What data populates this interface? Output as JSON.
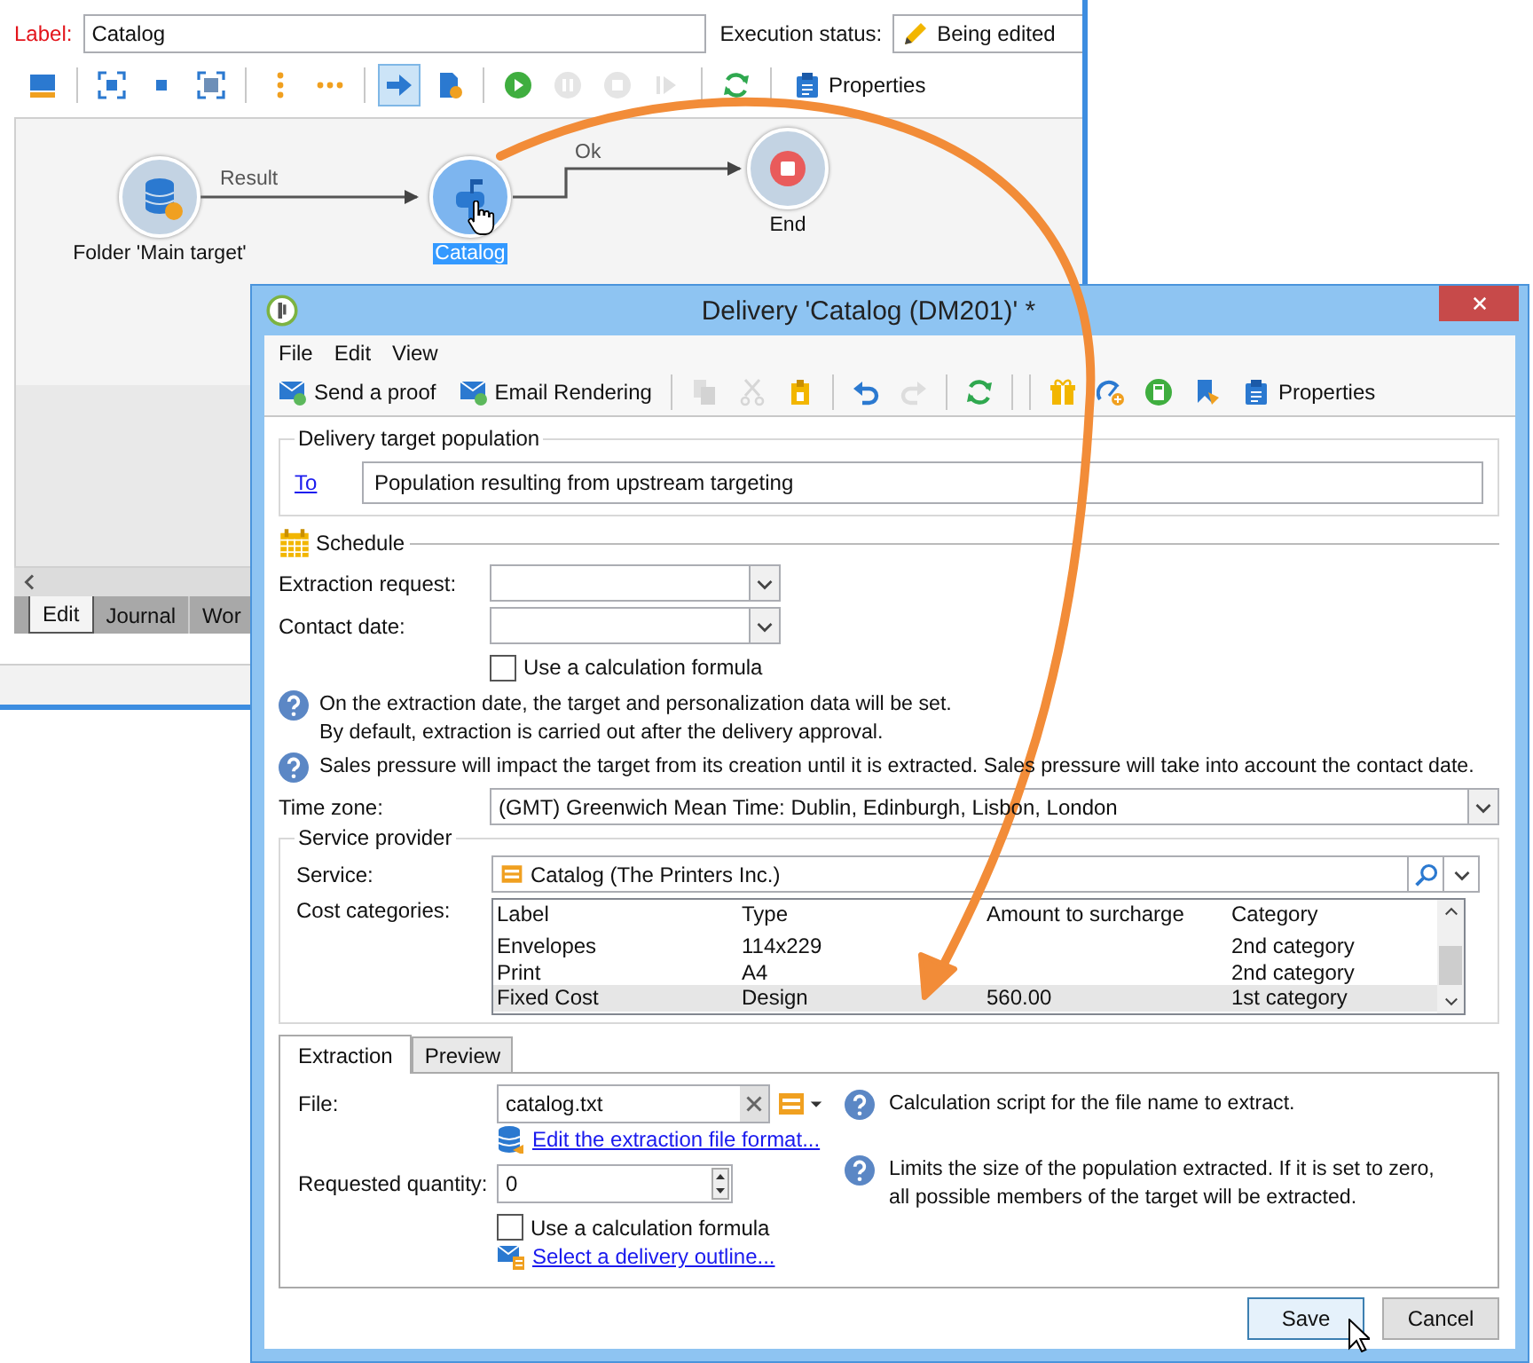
{
  "main_window": {
    "label_caption": "Label:",
    "label_value": "Catalog",
    "status_caption": "Execution status:",
    "status_value": "Being edited",
    "toolbar": [
      {
        "pressed": false,
        "disabled": false
      },
      {
        "pressed": false,
        "disabled": false
      },
      {
        "pressed": false,
        "disabled": false
      },
      {
        "pressed": false,
        "disabled": false
      },
      {
        "pressed": false,
        "disabled": false
      },
      {
        "pressed": false,
        "disabled": false
      },
      {
        "pressed": true,
        "disabled": false
      },
      {
        "pressed": false,
        "disabled": false
      },
      {
        "pressed": false,
        "disabled": false
      },
      {
        "pressed": false,
        "disabled": true
      },
      {
        "pressed": false,
        "disabled": true
      },
      {
        "pressed": false,
        "disabled": true
      },
      {
        "pressed": false,
        "disabled": false
      },
      {
        "pressed": false,
        "disabled": false,
        "label": "Properties"
      }
    ],
    "workflow": {
      "nodes": [
        {
          "label": "Folder 'Main target'",
          "selected": false
        },
        {
          "label": "Catalog",
          "selected": true
        },
        {
          "label": "End",
          "selected": false
        }
      ],
      "transitions": [
        {
          "label": "Result"
        },
        {
          "label": "Ok"
        }
      ]
    },
    "tabs": [
      {
        "label": "Edit",
        "selected": true
      },
      {
        "label": "Journal",
        "selected": false
      },
      {
        "label": "Wor",
        "selected": false
      }
    ]
  },
  "dialog": {
    "title": "Delivery 'Catalog (DM201)' *",
    "menu": [
      "File",
      "Edit",
      "View"
    ],
    "toolbar": [
      {
        "label": "Send a proof",
        "disabled": false
      },
      {
        "label": "Email Rendering",
        "disabled": false
      },
      {
        "disabled": true
      },
      {
        "disabled": true
      },
      {
        "disabled": false
      },
      {
        "disabled": false
      },
      {
        "disabled": true
      },
      {
        "disabled": false
      },
      {
        "disabled": false
      },
      {
        "disabled": false
      },
      {
        "disabled": false
      },
      {
        "disabled": false
      },
      {
        "label": "Properties",
        "disabled": false
      }
    ],
    "target_population": {
      "title": "Delivery target population",
      "link": "To",
      "value": "Population resulting from upstream targeting"
    },
    "schedule": {
      "title": "Schedule",
      "extraction_request_label": "Extraction request:",
      "contact_date_label": "Contact date:",
      "formula": {
        "label": "Use a calculation formula",
        "checked": false
      }
    },
    "notes": [
      "On the extraction date, the target and personalization data will be set.\nBy default, extraction is carried out after the delivery approval.",
      "Sales pressure will impact the target from its creation until it is extracted. Sales pressure will take into account the contact date."
    ],
    "time_zone": {
      "label": "Time zone:",
      "value": "(GMT) Greenwich Mean Time: Dublin, Edinburgh, Lisbon, London"
    },
    "service_provider": {
      "title": "Service provider",
      "service_label": "Service:",
      "service_value": "Catalog (The Printers Inc.)",
      "costs_label": "Cost categories:",
      "table": {
        "columns": [
          "Label",
          "Type",
          "Amount to surcharge",
          "Category"
        ],
        "rows": [
          {
            "label": "Envelopes",
            "type": "114x229",
            "category": "2nd category",
            "selected": false
          },
          {
            "label": "Print",
            "type": "A4",
            "category": "2nd category",
            "selected": false
          },
          {
            "label": "Fixed Cost",
            "type": "Design",
            "amount": "560.00",
            "category": "1st category",
            "selected": true
          }
        ]
      }
    },
    "tabs": [
      {
        "label": "Extraction",
        "selected": true
      },
      {
        "label": "Preview",
        "selected": false
      }
    ],
    "extraction": {
      "file_label": "File:",
      "file_value": "catalog.txt",
      "file_hint": "Calculation script for the file name to extract.",
      "format_link": "Edit the extraction file format...",
      "quantity_label": "Requested quantity:",
      "quantity_value": "0",
      "quantity_hint": "Limits the size of the population extracted. If it is set to zero,\nall possible members of the target will be extracted.",
      "formula": {
        "label": "Use a calculation formula",
        "checked": false
      },
      "outline_link": "Select a delivery outline..."
    },
    "buttons": [
      {
        "label": "Save",
        "default": true
      },
      {
        "label": "Cancel",
        "default": false
      }
    ]
  }
}
